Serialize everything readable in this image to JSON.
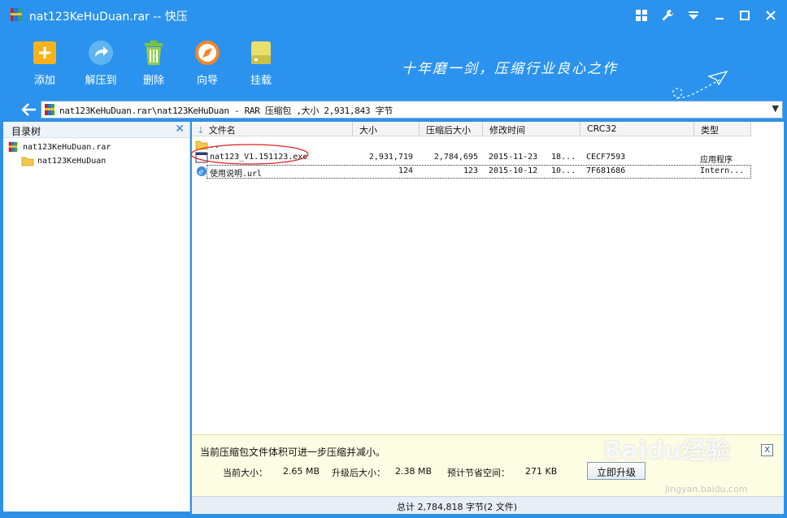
{
  "window": {
    "title": "nat123KeHuDuan.rar -- 快压"
  },
  "toolbar": {
    "add": "添加",
    "extract": "解压到",
    "delete": "删除",
    "wizard": "向导",
    "mount": "挂载",
    "slogan": "十年磨一剑，压缩行业良心之作"
  },
  "address": {
    "path": "nat123KeHuDuan.rar\\nat123KeHuDuan - RAR 压缩包 ,大小 2,931,843 字节"
  },
  "tree": {
    "title": "目录树",
    "items": [
      {
        "label": "nat123KeHuDuan.rar"
      },
      {
        "label": "nat123KeHuDuan"
      }
    ]
  },
  "columns": {
    "name": "文件名",
    "size": "大小",
    "packed": "压缩后大小",
    "modified": "修改时间",
    "crc": "CRC32",
    "type": "类型"
  },
  "files": [
    {
      "name": "..",
      "size": "",
      "packed": "",
      "date": "",
      "time": "",
      "crc": "",
      "type": ""
    },
    {
      "name": "nat123_V1.151123.exe",
      "size": "2,931,719",
      "packed": "2,784,695",
      "date": "2015-11-23",
      "time": "18...",
      "crc": "CECF7593",
      "type": "应用程序"
    },
    {
      "name": "使用说明.url",
      "size": "124",
      "packed": "123",
      "date": "2015-10-12",
      "time": "10...",
      "crc": "7F681686",
      "type": "Intern..."
    }
  ],
  "promo": {
    "message": "当前压缩包文件体积可进一步压缩并减小。",
    "current_label": "当前大小：",
    "current_value": "2.65 MB",
    "upgraded_label": "升级后大小：",
    "upgraded_value": "2.38 MB",
    "saved_label": "预计节省空间：",
    "saved_value": "271 KB",
    "button": "立即升级",
    "close": "X"
  },
  "status": {
    "text": "总计   2,784,818 字节(2 文件)"
  },
  "watermark": {
    "brand": "Baidu经验",
    "url": "jingyan.baidu.com"
  },
  "colors": {
    "titlebar": "#2b93ee",
    "promo_bg": "#fdfde3",
    "annotation": "#e02020"
  }
}
